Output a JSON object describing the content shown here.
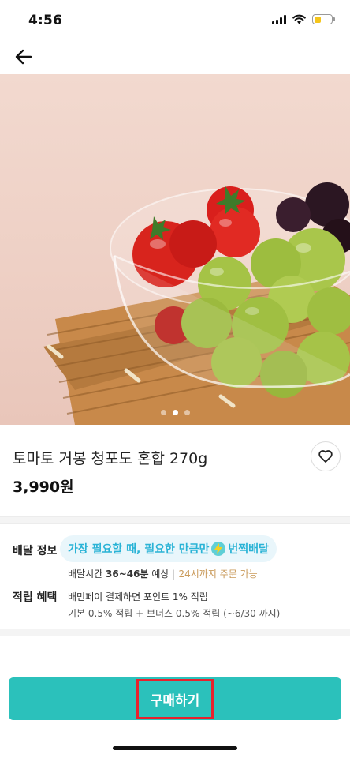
{
  "status": {
    "time": "4:56"
  },
  "product": {
    "name": "토마토 거봉 청포도 혼합 270g",
    "price": "3,990원",
    "images_count": 3,
    "current_image": 2
  },
  "delivery": {
    "label": "배달 정보",
    "pill_text_a": "가장 필요할 때, 필요한 만큼만",
    "pill_text_b": "번쩍배달",
    "time_prefix": "배달시간",
    "time_range": "36~46분",
    "time_suffix": "예상",
    "order_until": "24시까지 주문 가능"
  },
  "reward": {
    "label": "적립 혜택",
    "main": "배민페이 결제하면 포인트 1% 적립",
    "sub": "기본 0.5% 적립 + 보너스 0.5% 적립 (~6/30 까지)"
  },
  "buy": {
    "label": "구매하기"
  },
  "colors": {
    "accent": "#2bc1bb",
    "highlight": "#e8212d",
    "pill_text": "#2ab3d6"
  },
  "icons": [
    "back-arrow-icon",
    "heart-icon",
    "bolt-icon",
    "signal-icon",
    "wifi-icon",
    "battery-icon"
  ]
}
